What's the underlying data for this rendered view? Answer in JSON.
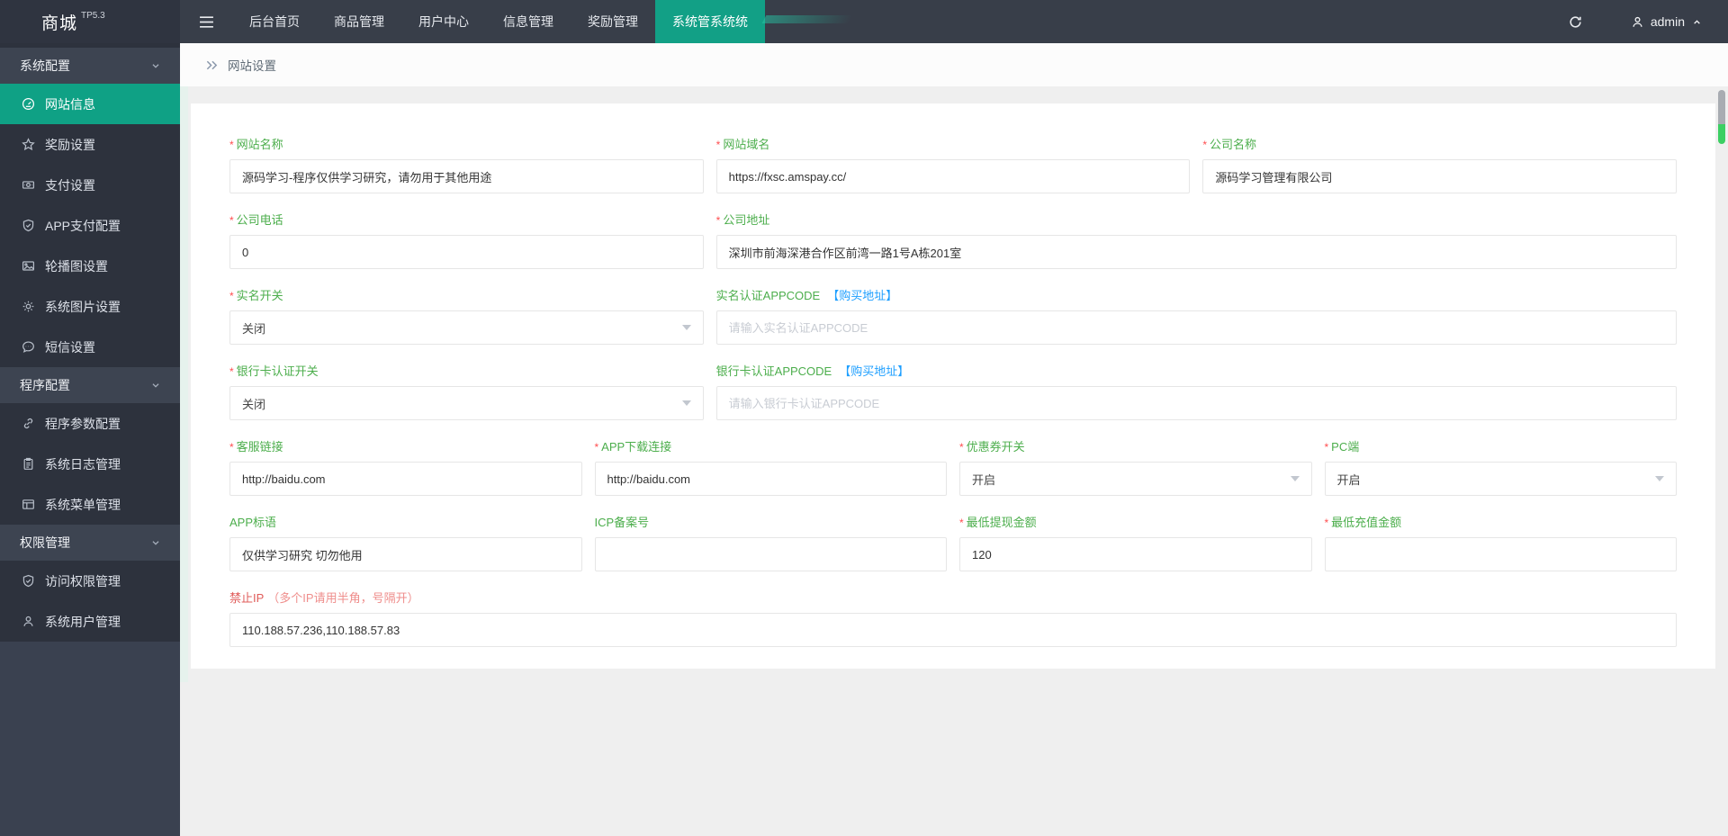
{
  "topbar": {
    "logo": "商城",
    "logo_version": "TP5.3",
    "nav": [
      "后台首页",
      "商品管理",
      "用户中心",
      "信息管理",
      "奖励管理"
    ],
    "active_tab": "系统管系统统",
    "username": "admin"
  },
  "sidebar": {
    "sections": [
      {
        "label": "系统配置",
        "items": [
          {
            "icon": "gauge-icon",
            "label": "网站信息",
            "active": true
          },
          {
            "icon": "star-icon",
            "label": "奖励设置"
          },
          {
            "icon": "banknote-icon",
            "label": "支付设置"
          },
          {
            "icon": "shield-check-icon",
            "label": "APP支付配置"
          },
          {
            "icon": "image-icon",
            "label": "轮播图设置"
          },
          {
            "icon": "gear-icon",
            "label": "系统图片设置"
          },
          {
            "icon": "chat-icon",
            "label": "短信设置"
          }
        ]
      },
      {
        "label": "程序配置",
        "items": [
          {
            "icon": "link-icon",
            "label": "程序参数配置"
          },
          {
            "icon": "clipboard-icon",
            "label": "系统日志管理"
          },
          {
            "icon": "window-icon",
            "label": "系统菜单管理"
          }
        ]
      },
      {
        "label": "权限管理",
        "items": [
          {
            "icon": "shield-check-icon",
            "label": "访问权限管理"
          },
          {
            "icon": "user-icon",
            "label": "系统用户管理"
          }
        ]
      }
    ]
  },
  "breadcrumb": {
    "title": "网站设置"
  },
  "form": {
    "required_marker": "*",
    "site_name": {
      "label": "网站名称",
      "value": "源码学习-程序仅供学习研究，请勿用于其他用途"
    },
    "site_domain": {
      "label": "网站域名",
      "value": "https://fxsc.amspay.cc/"
    },
    "company_name": {
      "label": "公司名称",
      "value": "源码学习管理有限公司"
    },
    "company_phone": {
      "label": "公司电话",
      "value": "0"
    },
    "company_address": {
      "label": "公司地址",
      "value": "深圳市前海深港合作区前湾一路1号A栋201室"
    },
    "realname_switch": {
      "label": "实名开关",
      "value": "关闭"
    },
    "realname_appcode": {
      "label": "实名认证APPCODE",
      "link": "【购买地址】",
      "placeholder": "请输入实名认证APPCODE",
      "value": ""
    },
    "bankcard_switch": {
      "label": "银行卡认证开关",
      "value": "关闭"
    },
    "bankcard_appcode": {
      "label": "银行卡认证APPCODE",
      "link": "【购买地址】",
      "placeholder": "请输入银行卡认证APPCODE",
      "value": ""
    },
    "service_link": {
      "label": "客服链接",
      "value": "http://baidu.com"
    },
    "app_download_link": {
      "label": "APP下载连接",
      "value": "http://baidu.com"
    },
    "coupon_switch": {
      "label": "优惠券开关",
      "value": "开启"
    },
    "pc_switch": {
      "label": "PC端",
      "value": "开启"
    },
    "app_slogan": {
      "label": "APP标语",
      "value": "仅供学习研究 切勿他用"
    },
    "icp_number": {
      "label": "ICP备案号",
      "value": ""
    },
    "min_withdraw": {
      "label": "最低提现金额",
      "value": "120"
    },
    "min_recharge": {
      "label": "最低充值金额",
      "value": ""
    },
    "forbidden_ip": {
      "label": "禁止IP",
      "note": "（多个IP请用半角，号隔开）",
      "value": "110.188.57.236,110.188.57.83"
    }
  },
  "colors": {
    "accent_teal": "#12a086",
    "label_green": "#4cae4c",
    "link_blue": "#1e9fff",
    "asterisk_red": "#ff4d4f",
    "warning_red": "#e05c5a",
    "topbar_bg": "#383e49",
    "sidebar_bg": "#2d323d"
  }
}
